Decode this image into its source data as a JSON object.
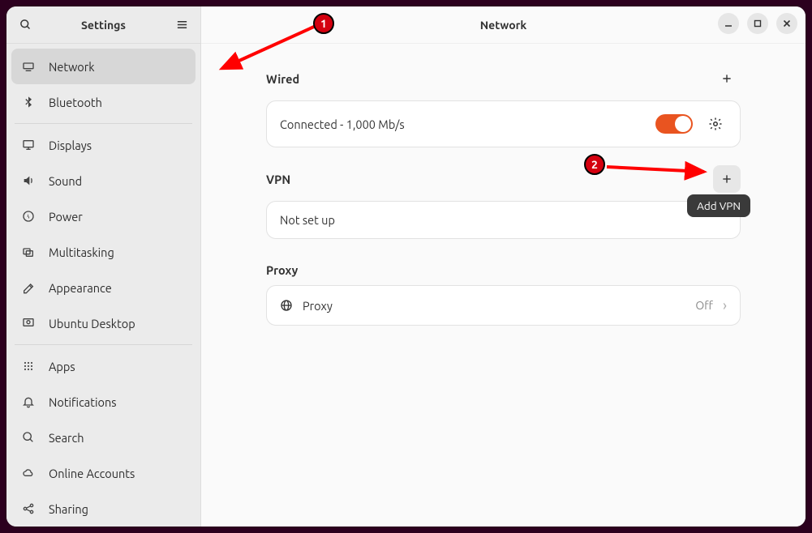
{
  "sidebar": {
    "title": "Settings",
    "items": [
      {
        "label": "Network",
        "icon": "network",
        "selected": true
      },
      {
        "label": "Bluetooth",
        "icon": "bluetooth"
      }
    ],
    "items2": [
      {
        "label": "Displays",
        "icon": "displays"
      },
      {
        "label": "Sound",
        "icon": "sound"
      },
      {
        "label": "Power",
        "icon": "power"
      },
      {
        "label": "Multitasking",
        "icon": "multitasking"
      },
      {
        "label": "Appearance",
        "icon": "appearance"
      },
      {
        "label": "Ubuntu Desktop",
        "icon": "ubuntu"
      }
    ],
    "items3": [
      {
        "label": "Apps",
        "icon": "apps"
      },
      {
        "label": "Notifications",
        "icon": "notifications"
      },
      {
        "label": "Search",
        "icon": "search"
      },
      {
        "label": "Online Accounts",
        "icon": "cloud"
      },
      {
        "label": "Sharing",
        "icon": "sharing"
      }
    ]
  },
  "main": {
    "title": "Network",
    "wired": {
      "heading": "Wired",
      "status": "Connected - 1,000 Mb/s"
    },
    "vpn": {
      "heading": "VPN",
      "status": "Not set up",
      "tooltip": "Add VPN"
    },
    "proxy": {
      "heading": "Proxy",
      "label": "Proxy",
      "value": "Off"
    }
  },
  "annotations": {
    "step1": "1",
    "step2": "2"
  }
}
